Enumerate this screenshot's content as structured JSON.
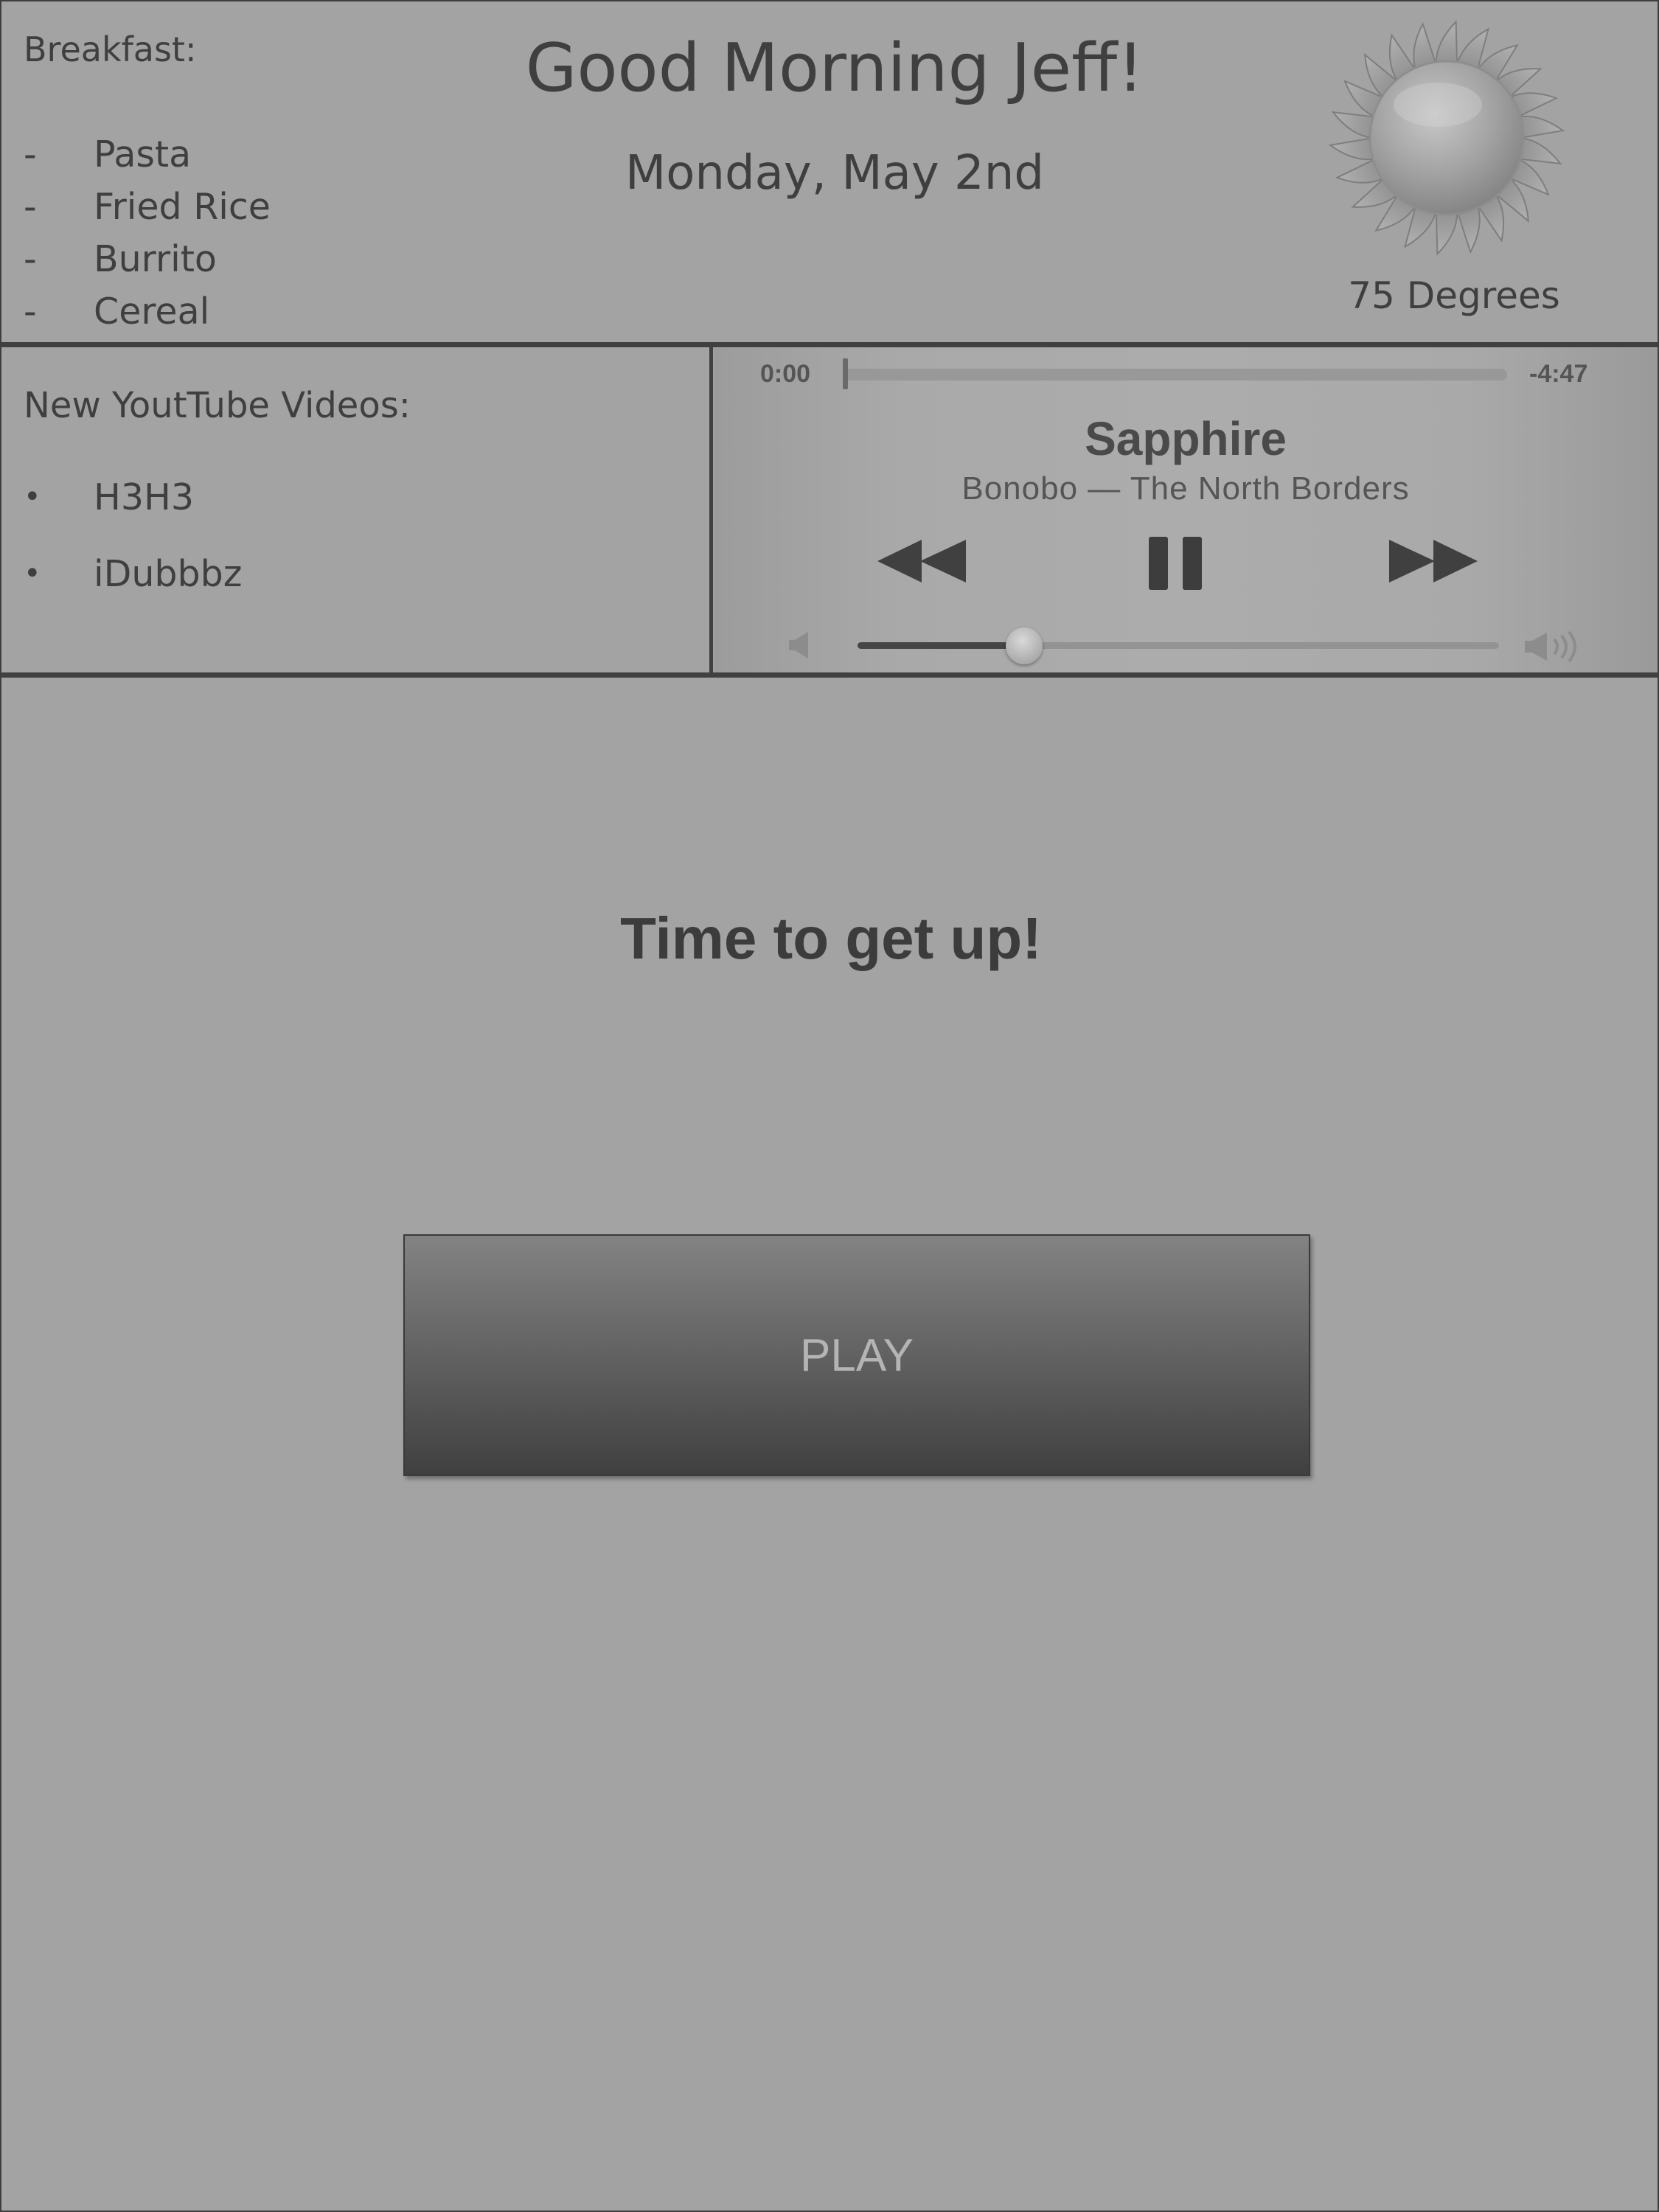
{
  "header": {
    "greeting": "Good Morning Jeff!",
    "date": "Monday, May 2nd"
  },
  "breakfast": {
    "title": "Breakfast:",
    "items": [
      {
        "marker": "-",
        "label": "Pasta"
      },
      {
        "marker": "-",
        "label": "Fried Rice"
      },
      {
        "marker": "-",
        "label": "Burrito"
      },
      {
        "marker": "-",
        "label": "Cereal"
      }
    ]
  },
  "weather": {
    "icon": "sun-icon",
    "temperature": "75 Degrees"
  },
  "youtube": {
    "title": "New YoutTube Videos:",
    "items": [
      {
        "marker": "•",
        "label": "H3H3"
      },
      {
        "marker": "•",
        "label": "iDubbbz"
      }
    ]
  },
  "player": {
    "elapsed": "0:00",
    "remaining": "-4:47",
    "song_title": "Sapphire",
    "song_subtitle": "Bonobo — The North Borders",
    "progress_fraction": 0,
    "volume_fraction": 0.26,
    "controls": {
      "rewind_icon": "rewind-icon",
      "pause_icon": "pause-icon",
      "fast_forward_icon": "fast-forward-icon",
      "volume_low_icon": "volume-low-icon",
      "volume_high_icon": "volume-high-icon"
    }
  },
  "main": {
    "message": "Time to get up!",
    "play_button_label": "PLAY"
  }
}
